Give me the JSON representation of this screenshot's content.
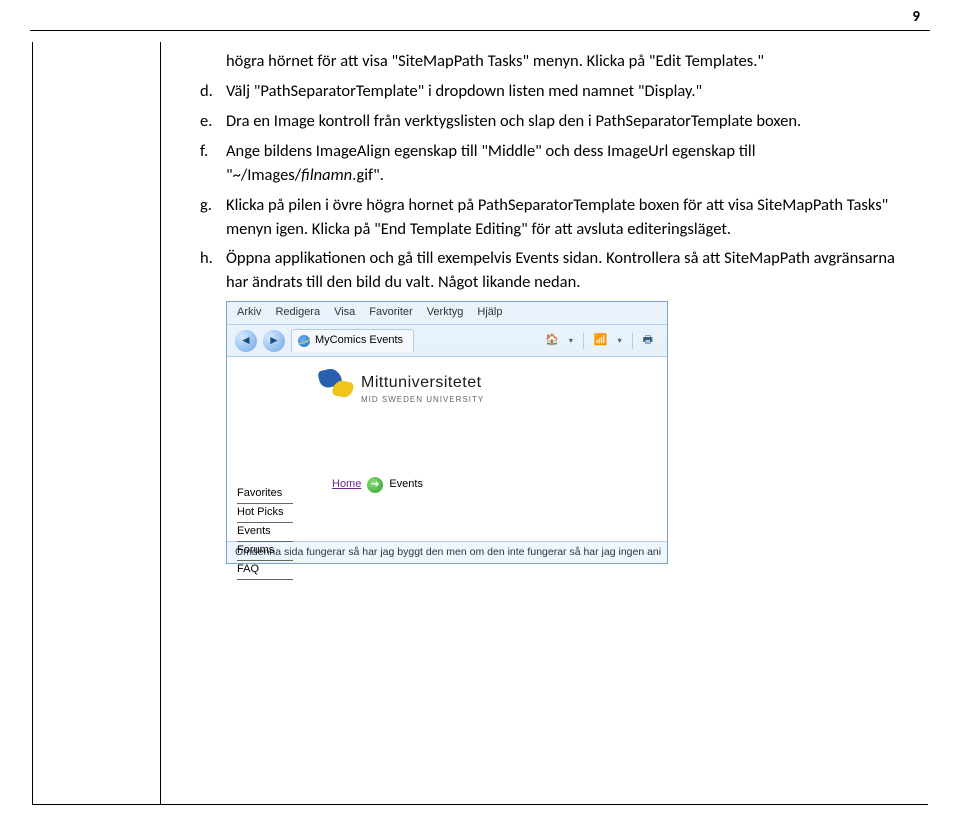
{
  "page_number": "9",
  "list": {
    "pre": "högra hörnet för att visa \"SiteMapPath Tasks\" menyn. Klicka på \"Edit Templates.\"",
    "d": "Välj \"PathSeparatorTemplate\" i dropdown listen med namnet \"Display.\"",
    "e": "Dra en Image kontroll från verktygslisten och slap den i PathSeparatorTemplate boxen.",
    "f_1": "Ange bildens ImageAlign egenskap till \"Middle\" och dess ImageUrl egenskap till \"~/Images/",
    "f_filnamn": "filnamn",
    "f_2": ".gif\".",
    "g": "Klicka på pilen i övre högra hornet på PathSeparatorTemplate boxen för att visa SiteMapPath Tasks\" menyn igen. Klicka på \"End Template Editing\" för att avsluta editeringsläget.",
    "h": "Öppna applikationen och gå till exempelvis Events sidan. Kontrollera så att SiteMapPath avgränsarna har ändrats till den bild du valt. Något likande nedan."
  },
  "browser": {
    "menu": {
      "arkiv": "Arkiv",
      "redigera": "Redigera",
      "visa": "Visa",
      "favoriter": "Favoriter",
      "verktyg": "Verktyg",
      "hjalp": "Hjälp"
    },
    "tab_title": "MyComics Events",
    "logo": {
      "title": "Mittuniversitetet",
      "sub": "MID SWEDEN UNIVERSITY"
    },
    "sidebar": {
      "favorites": "Favorites",
      "hotpicks": "Hot Picks",
      "events": "Events",
      "forums": "Forums",
      "faq": "FAQ"
    },
    "crumb": {
      "home": "Home",
      "events": "Events"
    },
    "status": "Omdenna sida fungerar så har jag byggt den men om den inte fungerar så har jag ingen ani"
  }
}
